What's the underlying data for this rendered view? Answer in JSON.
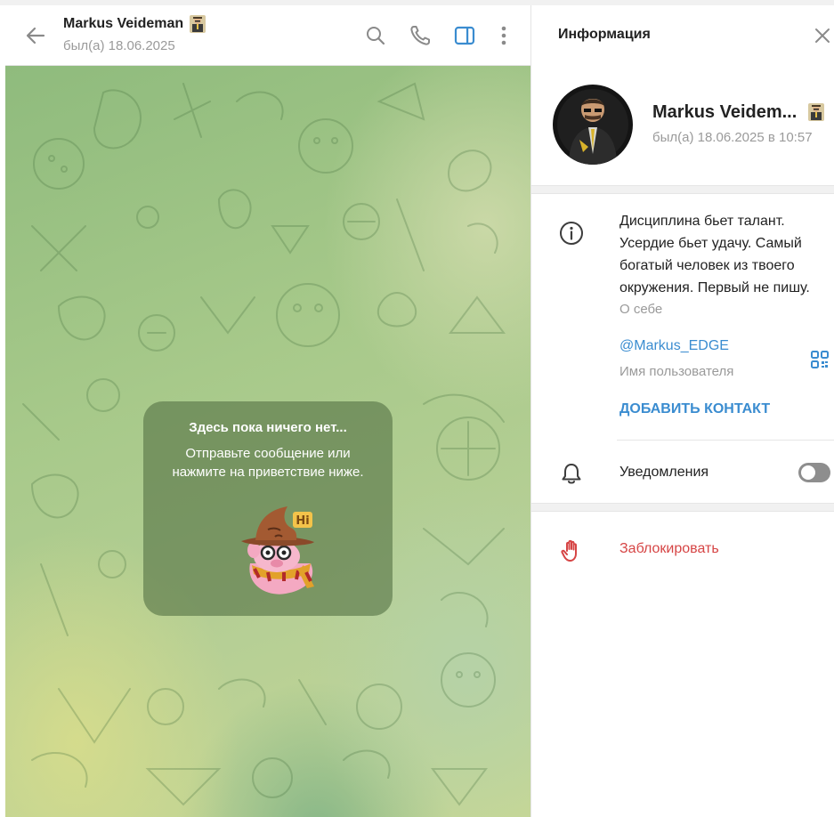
{
  "chat_header": {
    "name": "Markus Veideman",
    "status": "был(а) 18.06.2025",
    "icons": [
      "back-arrow-icon",
      "search-icon",
      "phone-icon",
      "sidebar-panel-icon",
      "more-vertical-icon"
    ]
  },
  "empty_state": {
    "title": "Здесь пока ничего нет...",
    "line1": "Отправьте сообщение или",
    "line2": "нажмите на приветствие ниже.",
    "sticker_text": "Hi"
  },
  "info_panel": {
    "title": "Информация",
    "profile": {
      "name": "Markus Veidem...",
      "status": "был(а) 18.06.2025 в 10:57"
    },
    "bio": {
      "line1": "Дисциплина бьет талант.",
      "line2": "Усердие бьет удачу. Самый",
      "line3": "богатый человек из твоего",
      "line4": "окружения. Первый не пишу.",
      "label": "О себе"
    },
    "username": {
      "value": "@Markus_EDGE",
      "label": "Имя пользователя"
    },
    "add_contact": "ДОБАВИТЬ КОНТАКТ",
    "notifications": {
      "label": "Уведомления",
      "enabled": false
    },
    "block": "Заблокировать"
  },
  "colors": {
    "accent": "#3a8cd0",
    "danger": "#d64545",
    "muted": "#9a9a9a",
    "active_icon": "#3a8cd0"
  }
}
